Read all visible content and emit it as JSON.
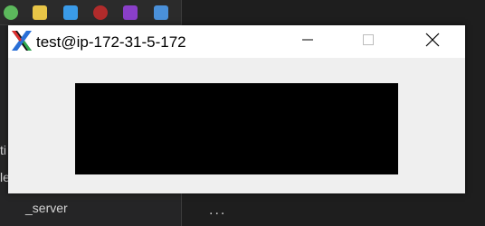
{
  "window": {
    "title": "test@ip-172-31-5-172",
    "icon": "x11-icon",
    "controls": {
      "minimize": "minimize-icon",
      "maximize": "maximize-icon",
      "close": "close-icon"
    }
  },
  "background": {
    "sidebar_partial_text_1": "ti",
    "sidebar_partial_text_2": "le",
    "sidebar_partial_text_3": "_server",
    "editor_ellipsis": "..."
  },
  "colors": {
    "titlebar": "#ffffff",
    "client_area": "#efefef",
    "canvas": "#000000",
    "desktop": "#1e1e1e"
  }
}
